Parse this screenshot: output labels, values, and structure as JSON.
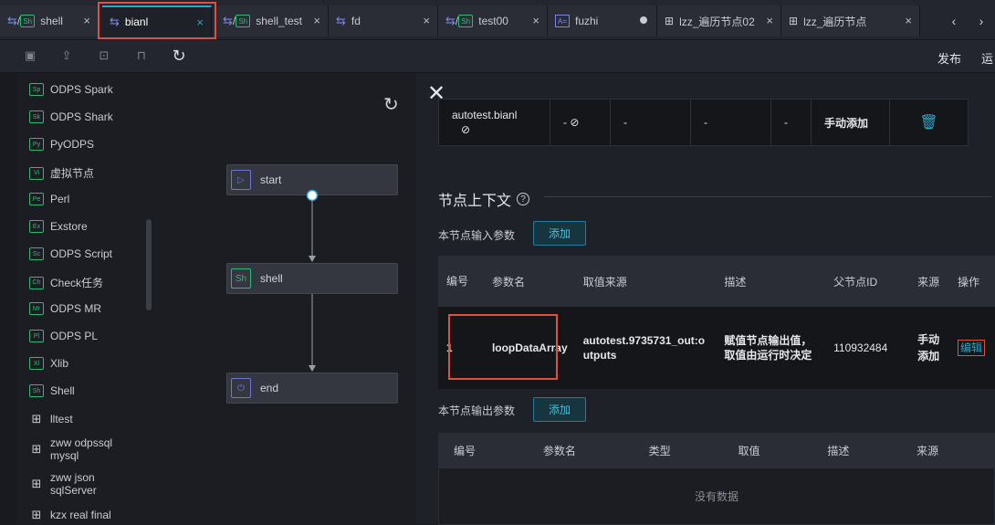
{
  "tabs": [
    {
      "label": "shell",
      "icon": "shell-node-icon"
    },
    {
      "label": "bianl",
      "icon": "flow-icon",
      "active": true
    },
    {
      "label": "shell_test",
      "icon": "shell-node-icon"
    },
    {
      "label": "fd",
      "icon": "flow-icon"
    },
    {
      "label": "test00",
      "icon": "shell-node-icon"
    },
    {
      "label": "fuzhi",
      "icon": "az-icon"
    },
    {
      "label": "lzz_遍历节点02",
      "icon": "tree-icon"
    },
    {
      "label": "lzz_遍历节点",
      "icon": "tree-icon"
    }
  ],
  "toolbar": {
    "publish": "发布",
    "run": "运"
  },
  "left_menu": [
    {
      "label": "ODPS Spark",
      "code": "Sp"
    },
    {
      "label": "ODPS Shark",
      "code": "Sk"
    },
    {
      "label": "PyODPS",
      "code": "Py"
    },
    {
      "label": "虚拟节点",
      "code": "Vi"
    },
    {
      "label": "Perl",
      "code": "Pe"
    },
    {
      "label": "Exstore",
      "code": "Ex"
    },
    {
      "label": "ODPS Script",
      "code": "Sc"
    },
    {
      "label": "Check任务",
      "code": "Ch"
    },
    {
      "label": "ODPS MR",
      "code": "Mr"
    },
    {
      "label": "ODPS PL",
      "code": "Pl"
    },
    {
      "label": "Xlib",
      "code": "Xl"
    },
    {
      "label": "Shell",
      "code": "Sh"
    },
    {
      "label": "lltest",
      "code": ""
    },
    {
      "label1": "zww odpssql",
      "label2": "mysql",
      "code": ""
    },
    {
      "label1": "zww json",
      "label2": "sqlServer",
      "code": ""
    },
    {
      "label": "kzx real final",
      "code": ""
    }
  ],
  "canvas": {
    "nodes": [
      {
        "label": "start",
        "icon_code": "▷"
      },
      {
        "label": "shell",
        "icon_code": "Sh"
      },
      {
        "label": "end",
        "icon_code": "⏻"
      }
    ]
  },
  "top_row": {
    "name": "autotest.bianl",
    "c2": "-",
    "c3": "-",
    "c4": "-",
    "c5": "-",
    "source": "手动添加"
  },
  "context": {
    "title": "节点上下文",
    "input_label": "本节点输入参数",
    "add_label": "添加",
    "input_headers": [
      "编号",
      "参数名",
      "取值来源",
      "描述",
      "父节点ID",
      "来源",
      "操作"
    ],
    "input_row": {
      "id": "1",
      "name": "loopDataArray",
      "value_source": "autotest.9735731_out:outputs",
      "desc": "赋值节点输出值，取值由运行时决定",
      "parent_id": "110932484",
      "source": "手动添加",
      "action": "编辑"
    },
    "output_label": "本节点输出参数",
    "output_headers": [
      "编号",
      "参数名",
      "类型",
      "取值",
      "描述",
      "来源"
    ],
    "empty_text": "没有数据"
  }
}
